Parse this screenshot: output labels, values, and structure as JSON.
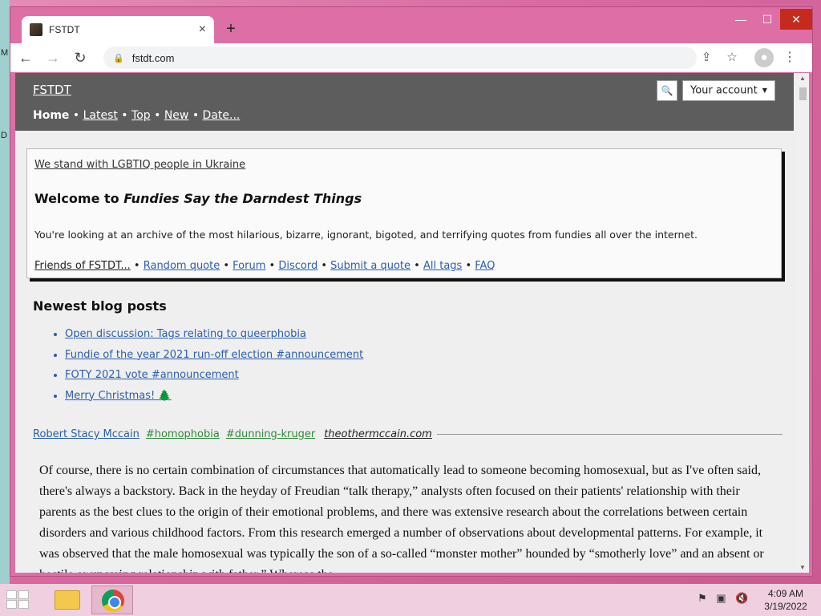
{
  "desktop": {
    "label_m": "M",
    "label_d": "D"
  },
  "browser": {
    "tab_title": "FSTDT",
    "tab_close": "×",
    "new_tab": "+",
    "window_min": "—",
    "window_max": "☐",
    "window_close": "✕",
    "back": "←",
    "forward": "→",
    "reload": "↻",
    "url": "fstdt.com",
    "lock_glyph": "🔒",
    "share_glyph": "⇪",
    "star_glyph": "☆",
    "profile_glyph": "●",
    "menu_glyph": "⋮"
  },
  "site": {
    "logo": "FSTDT",
    "nav": {
      "home": "Home",
      "latest": "Latest",
      "top": "Top",
      "new": "New",
      "date": "Date...",
      "sep": " • "
    },
    "search_glyph": "🔍",
    "account_label": "Your account",
    "account_caret": "▼"
  },
  "welcome": {
    "ukraine": "We stand with LGBTIQ people in Ukraine",
    "title_prefix": "Welcome to ",
    "title_em": "Fundies Say the Darndest Things",
    "description": "You're looking at an archive of the most hilarious, bizarre, ignorant, bigoted, and terrifying quotes from fundies all over the internet.",
    "friends": "Friends of FSTDT...",
    "links": [
      "Random quote",
      "Forum",
      "Discord",
      "Submit a quote",
      "All tags",
      "FAQ"
    ],
    "sep": " • "
  },
  "blog": {
    "heading": "Newest blog posts",
    "posts": [
      "Open discussion: Tags relating to queerphobia",
      "Fundie of the year 2021 run-off election #announcement",
      "FOTY 2021 vote #announcement",
      "Merry Christmas! 🌲"
    ]
  },
  "quote": {
    "author": "Robert Stacy Mccain",
    "tags": [
      "#homophobia",
      "#dunning-kruger"
    ],
    "source": "theothermccain.com",
    "body": "Of course, there is no certain combination of circumstances that automatically lead to someone becoming homosexual, but as I've often said, there's always a backstory. Back in the heyday of Freudian “talk therapy,” analysts often focused on their patients' relationship with their parents as the best clues to the origin of their emotional problems, and there was extensive research about the correlations between certain disorders and various childhood factors. From this research emerged a number of observations about developmental patterns. For example, it was observed that the male homosexual was typically the son of a so-called “monster mother” hounded by “smotherly love” and an absent or hostile or uncaring relationship with father.” Whereas the"
  },
  "taskbar": {
    "time": "4:09 AM",
    "date": "3/19/2022",
    "tray_flag": "⚑",
    "tray_network": "▣",
    "tray_volume": "🔇"
  }
}
